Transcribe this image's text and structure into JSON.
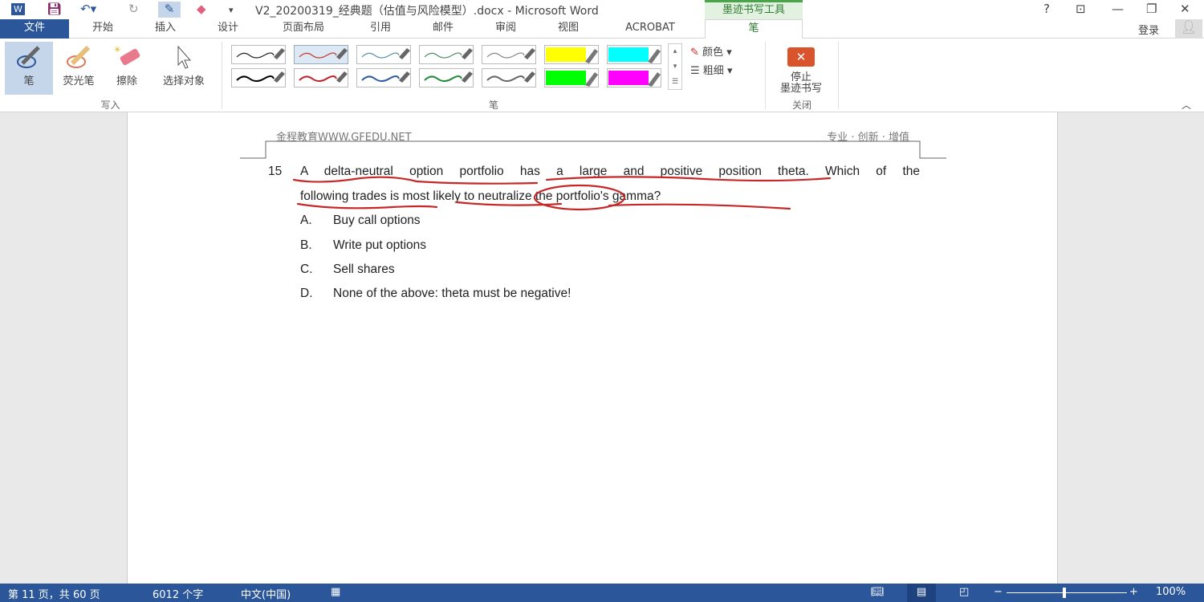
{
  "window": {
    "title": "V2_20200319_经典题（估值与风险模型）.docx - Microsoft Word",
    "context_tab": "墨迹书写工具",
    "help": "?",
    "login": "登录"
  },
  "tabs": [
    "文件",
    "开始",
    "插入",
    "设计",
    "页面布局",
    "引用",
    "邮件",
    "审阅",
    "视图",
    "ACROBAT",
    "笔"
  ],
  "ribbon": {
    "write_group": {
      "label": "写入",
      "buttons": [
        "笔",
        "荧光笔",
        "擦除",
        "选择对象"
      ]
    },
    "pens_group": {
      "label": "笔",
      "color_label": "颜色",
      "weight_label": "粗细"
    },
    "close_group": {
      "label": "关闭",
      "stop_label_1": "停止",
      "stop_label_2": "墨迹书写"
    },
    "pen_colors_row1": [
      "#222222",
      "#c0392b",
      "#5a8fa8",
      "#4e8f6a",
      "#888888",
      "#ffff00",
      "#00ffff"
    ],
    "pen_colors_row2": [
      "#000000",
      "#c0222a",
      "#2e5aa0",
      "#1f8a3a",
      "#666666",
      "#00ff00",
      "#ff00ff"
    ]
  },
  "document": {
    "header_left": "金程教育WWW.GFEDU.NET",
    "header_right": "专业 · 创新 · 增值",
    "question_number": "15",
    "question_line1": "A delta-neutral option portfolio has a large and positive position theta. Which of the",
    "question_line2": "following trades is most likely to neutralize the portfolio's gamma?",
    "options": [
      {
        "letter": "A.",
        "text": "Buy call options"
      },
      {
        "letter": "B.",
        "text": "Write put options"
      },
      {
        "letter": "C.",
        "text": "Sell shares"
      },
      {
        "letter": "D.",
        "text": "None of the above: theta must be negative!"
      }
    ],
    "ink_color": "#c62828"
  },
  "status": {
    "page": "第 11 页，共 60 页",
    "words": "6012 个字",
    "language": "中文(中国)",
    "zoom": "100%"
  }
}
